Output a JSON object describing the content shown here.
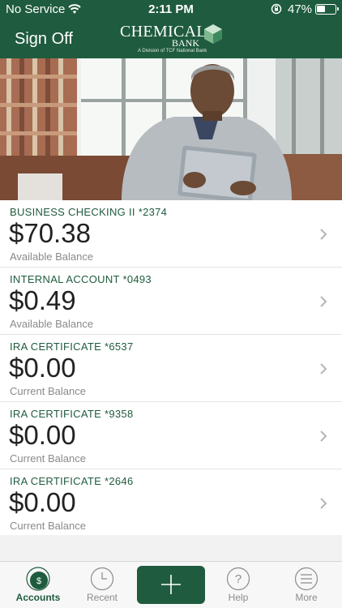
{
  "status_bar": {
    "carrier": "No Service",
    "time": "2:11 PM",
    "battery_percent": "47%",
    "battery_level": 0.47
  },
  "header": {
    "sign_off_label": "Sign Off",
    "logo_line1": "CHEMICAL",
    "logo_line2": "BANK",
    "logo_tagline": "A Division of TCF National Bank"
  },
  "accounts": [
    {
      "name": "BUSINESS CHECKING II *2374",
      "amount": "$70.38",
      "balance_label": "Available Balance"
    },
    {
      "name": "INTERNAL ACCOUNT *0493",
      "amount": "$0.49",
      "balance_label": "Available Balance"
    },
    {
      "name": "IRA CERTIFICATE *6537",
      "amount": "$0.00",
      "balance_label": "Current Balance"
    },
    {
      "name": "IRA CERTIFICATE *9358",
      "amount": "$0.00",
      "balance_label": "Current Balance"
    },
    {
      "name": "IRA CERTIFICATE *2646",
      "amount": "$0.00",
      "balance_label": "Current Balance"
    }
  ],
  "tabs": {
    "accounts": "Accounts",
    "accounts_icon_text": "$",
    "recent": "Recent",
    "help": "Help",
    "help_icon_text": "?",
    "more": "More"
  },
  "colors": {
    "brand_green": "#1f5b3e",
    "tab_inactive": "#8c8c8c"
  }
}
